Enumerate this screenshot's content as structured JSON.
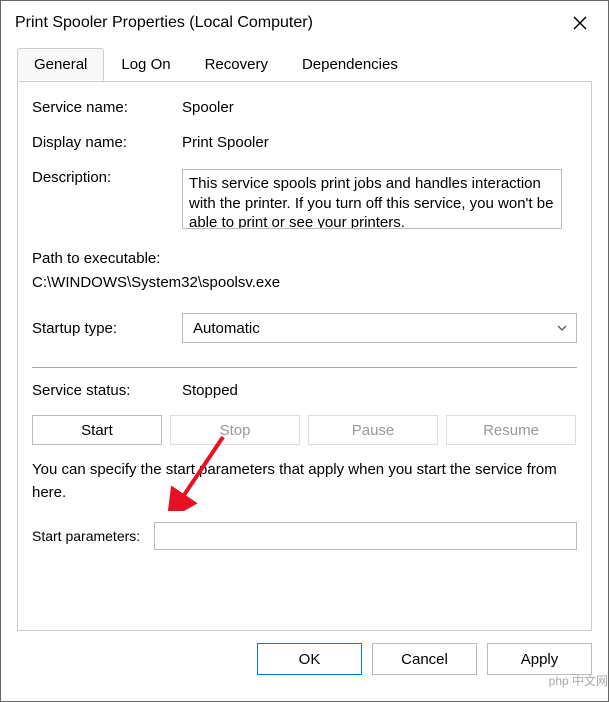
{
  "titlebar": {
    "title": "Print Spooler Properties (Local Computer)"
  },
  "tabs": {
    "general": "General",
    "logon": "Log On",
    "recovery": "Recovery",
    "dependencies": "Dependencies"
  },
  "labels": {
    "service_name": "Service name:",
    "display_name": "Display name:",
    "description": "Description:",
    "path_exec": "Path to executable:",
    "startup_type": "Startup type:",
    "service_status": "Service status:",
    "start_params": "Start parameters:",
    "note": "You can specify the start parameters that apply when you start the service from here."
  },
  "values": {
    "service_name": "Spooler",
    "display_name": "Print Spooler",
    "description": "This service spools print jobs and handles interaction with the printer.  If you turn off this service, you won't be able to print or see your printers.",
    "path": "C:\\WINDOWS\\System32\\spoolsv.exe",
    "startup_type": "Automatic",
    "status": "Stopped",
    "start_params": ""
  },
  "buttons": {
    "start": "Start",
    "stop": "Stop",
    "pause": "Pause",
    "resume": "Resume",
    "ok": "OK",
    "cancel": "Cancel",
    "apply": "Apply"
  },
  "watermark": "php 中文网"
}
